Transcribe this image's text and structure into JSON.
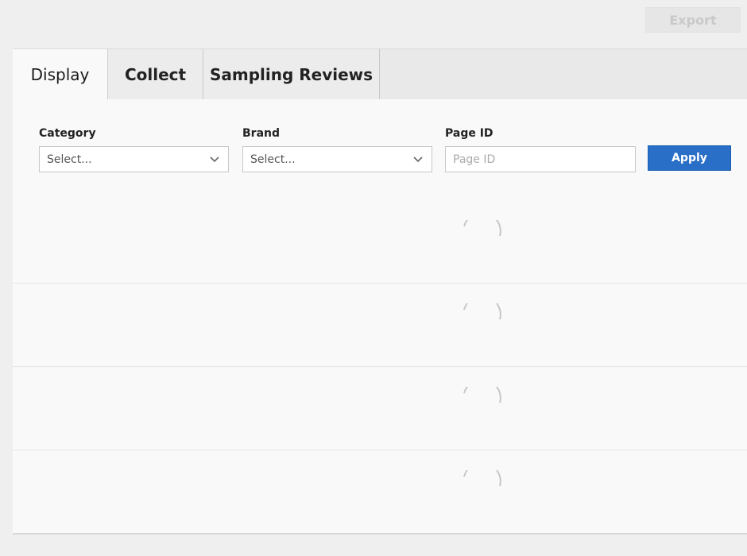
{
  "toolbar": {
    "export_label": "Export"
  },
  "tabs": [
    {
      "label": "Display",
      "active": true
    },
    {
      "label": "Collect",
      "active": false
    },
    {
      "label": "Sampling Reviews",
      "active": false
    }
  ],
  "filters": {
    "category": {
      "label": "Category",
      "value": "Select..."
    },
    "brand": {
      "label": "Brand",
      "value": "Select..."
    },
    "page_id": {
      "label": "Page ID",
      "placeholder": "Page ID",
      "value": ""
    },
    "apply_label": "Apply"
  },
  "colors": {
    "accent": "#2a6fc7",
    "background": "#efefef",
    "panel": "#f9f9f9"
  },
  "icons": {
    "dropdown": "chevron-down-icon",
    "loading": "loading-spinner-icon"
  },
  "loading_rows": 4
}
